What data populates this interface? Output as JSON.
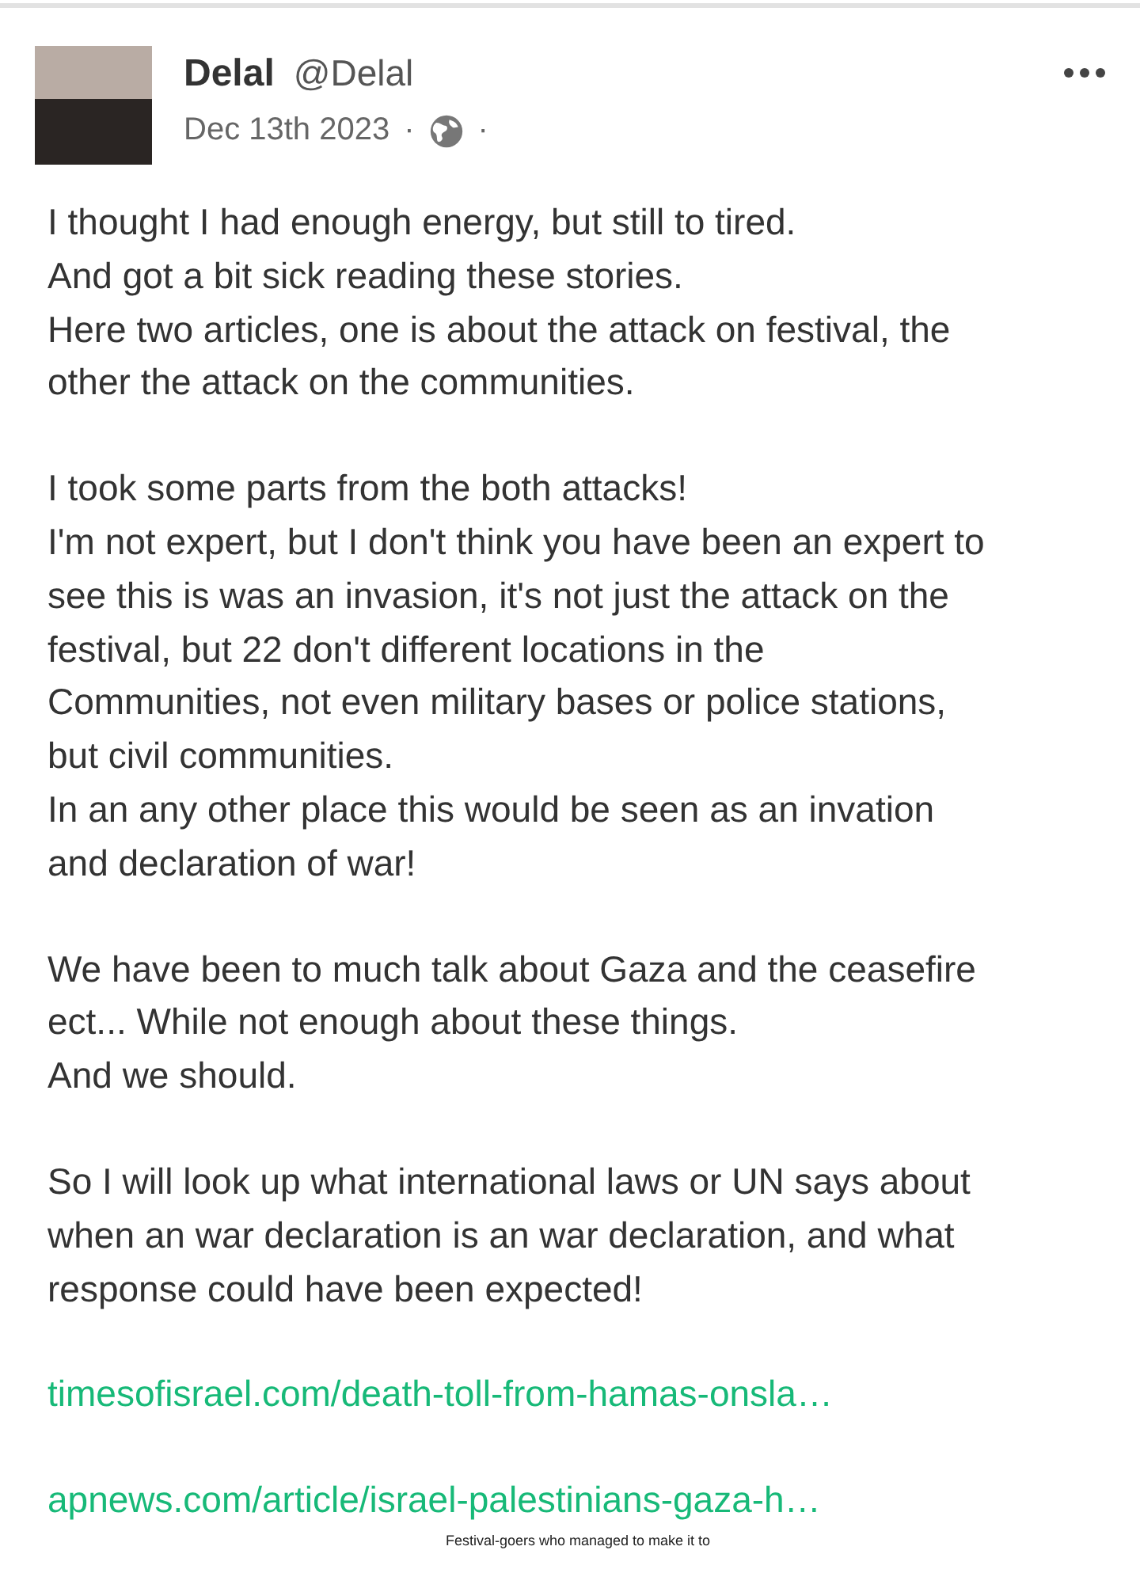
{
  "post": {
    "author": {
      "name": "Delal",
      "handle": "@Delal"
    },
    "date": "Dec 13th 2023",
    "separator": "·",
    "body": [
      {
        "lines": [
          "I thought I had enough energy, but still to tired.",
          "And got a bit sick reading these stories.",
          "Here two articles, one is about the attack on festival, the",
          "other the attack on the communities."
        ]
      },
      {
        "lines": [
          "I took some parts from the both attacks!",
          "I'm not expert, but I don't think you have been an expert to",
          "see this is was an invasion, it's not just the attack on the",
          "festival, but 22 don't different locations in the",
          "Communities, not even military bases or police stations,",
          "but civil communities.",
          "In an any other place this would be seen as an invation",
          "and declaration of war!"
        ]
      },
      {
        "lines": [
          "We have been to much talk about Gaza and the ceasefire",
          "ect... While not enough about these things.",
          "And we should."
        ]
      },
      {
        "lines": [
          "So I will look up what international laws or UN says about",
          "when an war declaration is an war declaration, and what",
          "response could have been expected!"
        ]
      }
    ],
    "links": [
      "timesofisrael.com/death-toll-from-hamas-onsla…",
      "apnews.com/article/israel-palestinians-gaza-h…"
    ],
    "preview_caption": "Festival-goers who managed to make it to"
  }
}
